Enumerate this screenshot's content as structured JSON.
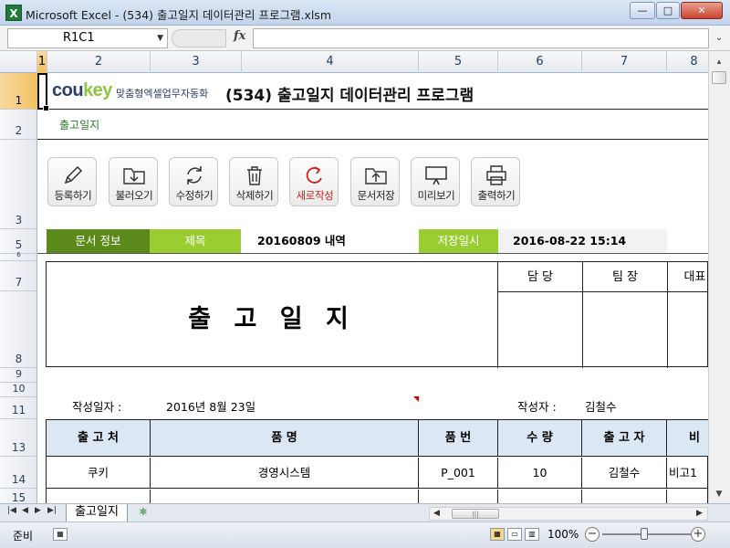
{
  "window": {
    "title": "Microsoft Excel - (534) 출고일지 데이터관리 프로그램.xlsm",
    "minimize": "—",
    "maximize": "□",
    "close": "✕"
  },
  "formula_bar": {
    "name_box": "R1C1",
    "fx": "fx",
    "formula": ""
  },
  "columns": [
    "1",
    "2",
    "3",
    "4",
    "5",
    "6",
    "7",
    "8"
  ],
  "rows": [
    "1",
    "2",
    "3",
    "5",
    "6",
    "7",
    "8",
    "9",
    "10",
    "11",
    "13",
    "14",
    "15"
  ],
  "header": {
    "logo": "cou",
    "logo_accent": "key",
    "logo_tagline": "맞춤형엑셀업무자동화",
    "title": "(534) 출고일지 데이터관리 프로그램",
    "sheet_subtitle": "출고일지"
  },
  "toolbar": [
    {
      "label": "등록하기",
      "icon": "pencil-icon"
    },
    {
      "label": "불러오기",
      "icon": "folder-download-icon"
    },
    {
      "label": "수정하기",
      "icon": "refresh-icon"
    },
    {
      "label": "삭제하기",
      "icon": "trash-icon"
    },
    {
      "label": "새로작성",
      "icon": "new-document-icon"
    },
    {
      "label": "문서저장",
      "icon": "folder-upload-icon"
    },
    {
      "label": "미리보기",
      "icon": "monitor-icon"
    },
    {
      "label": "출력하기",
      "icon": "printer-icon"
    }
  ],
  "info": {
    "doc_info_label": "문서 정보",
    "subject_label": "제목",
    "subject_value": "20160809 내역",
    "saved_label": "저장일시",
    "saved_value": "2016-08-22 15:14"
  },
  "document": {
    "title": "출 고 일 지",
    "signoff": [
      "담 당",
      "팀 장",
      "대표"
    ]
  },
  "meta": {
    "date_label": "작성일자 :",
    "date_value": "2016년 8월 23일",
    "author_label": "작성자 :",
    "author_value": "김철수"
  },
  "table": {
    "headers": [
      "출 고 처",
      "품        명",
      "품 번",
      "수 량",
      "출 고 자",
      "비"
    ],
    "rows": [
      [
        "쿠키",
        "경영시스템",
        "P_001",
        "10",
        "김철수",
        "비고1"
      ]
    ]
  },
  "tabs": {
    "active": "출고일지"
  },
  "status": {
    "ready": "준비",
    "zoom": "100%"
  },
  "colors": {
    "accent_dark_green": "#5b8a1a",
    "accent_light_green": "#9acd32",
    "table_header": "#dbe7f3",
    "delete_red": "#cc2020"
  }
}
